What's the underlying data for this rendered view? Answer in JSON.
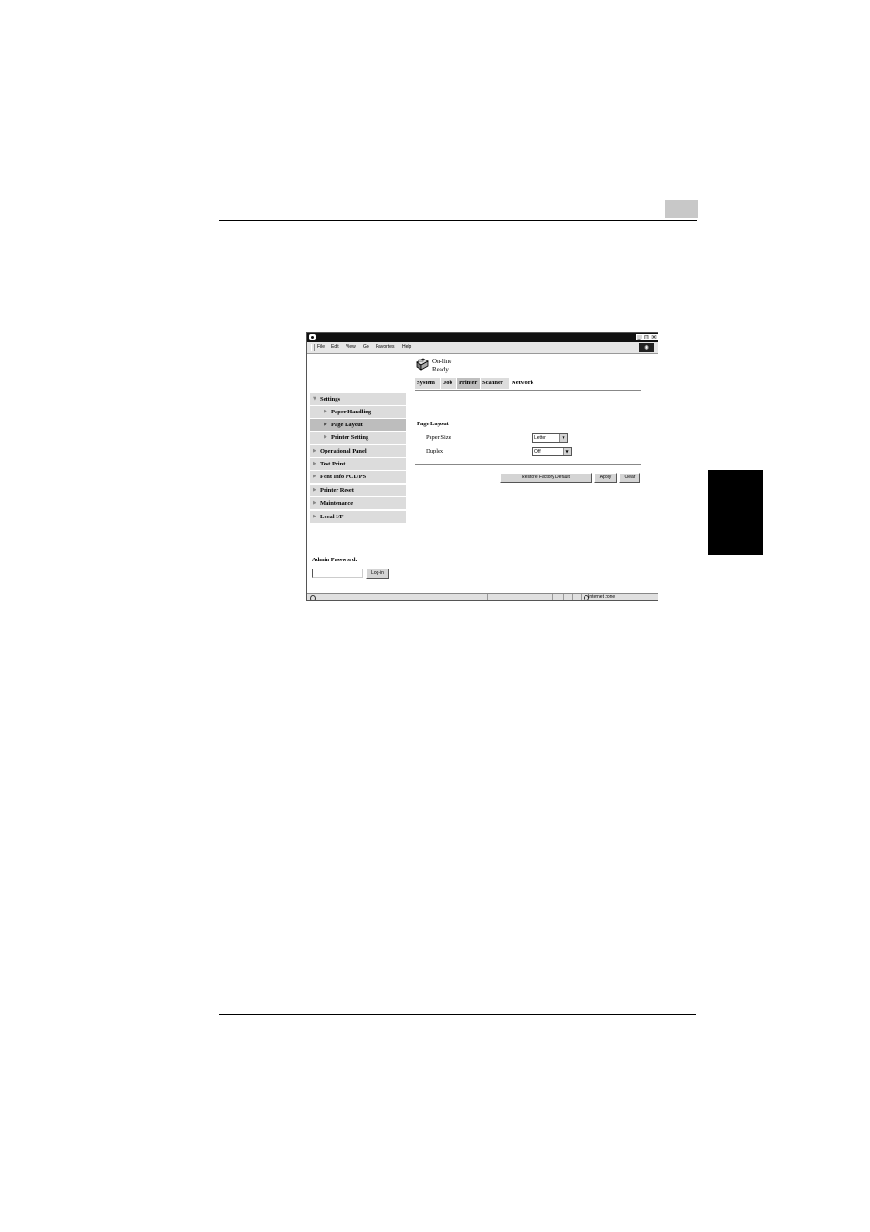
{
  "window": {
    "menu": [
      "File",
      "Edit",
      "View",
      "Go",
      "Favorites",
      "Help"
    ],
    "controls": {
      "minimize": "_",
      "maximize": "□",
      "close": "×"
    },
    "statusbar": {
      "zone": "Internet zone"
    }
  },
  "status": {
    "line1": "On-line",
    "line2": "Ready"
  },
  "tabs": [
    {
      "label": "System",
      "active": false
    },
    {
      "label": "Job",
      "active": false
    },
    {
      "label": "Printer",
      "active": true
    },
    {
      "label": "Scanner",
      "active": false
    },
    {
      "label": "Network",
      "active": false
    }
  ],
  "sidebar": {
    "items": [
      {
        "label": "Settings",
        "level": 0,
        "expanded": true,
        "selected": false
      },
      {
        "label": "Paper Handling",
        "level": 1,
        "selected": false
      },
      {
        "label": "Page Layout",
        "level": 1,
        "selected": true
      },
      {
        "label": "Printer Setting",
        "level": 1,
        "selected": false
      },
      {
        "label": "Operational Panel",
        "level": 0,
        "selected": false
      },
      {
        "label": "Test Print",
        "level": 0,
        "selected": false
      },
      {
        "label": "Font Info PCL/PS",
        "level": 0,
        "selected": false
      },
      {
        "label": "Printer Reset",
        "level": 0,
        "selected": false
      },
      {
        "label": "Maintenance",
        "level": 0,
        "selected": false
      },
      {
        "label": "Local I/F",
        "level": 0,
        "selected": false
      }
    ],
    "admin_label": "Admin Password:",
    "login_button": "Log-in"
  },
  "form": {
    "title": "Page Layout",
    "paper_size": {
      "label": "Paper Size",
      "value": "Letter"
    },
    "duplex": {
      "label": "Duplex",
      "value": "Off"
    },
    "buttons": {
      "restore": "Restore Factory Default",
      "apply": "Apply",
      "clear": "Clear"
    }
  },
  "colors": {
    "side_tab": "#000000",
    "page_box": "#c8c8c8"
  }
}
